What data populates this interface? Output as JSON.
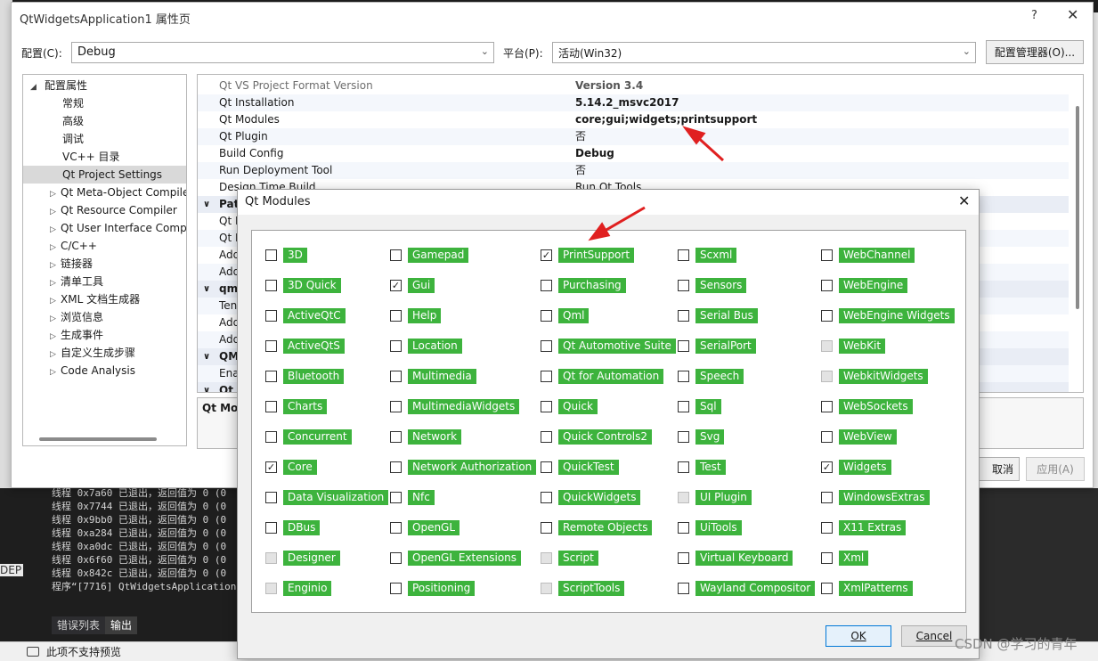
{
  "prop_dialog": {
    "title": "QtWidgetsApplication1 属性页",
    "help": "?",
    "close": "✕",
    "config_label": "配置(C):",
    "config_value": "Debug",
    "platform_label": "平台(P):",
    "platform_value": "活动(Win32)",
    "config_manager": "配置管理器(O)...",
    "cancel": "取消",
    "apply": "应用(A)"
  },
  "tree": [
    {
      "label": "配置属性",
      "arrow": "◢",
      "indent": 0
    },
    {
      "label": "常规",
      "arrow": "",
      "indent": 1
    },
    {
      "label": "高级",
      "arrow": "",
      "indent": 1
    },
    {
      "label": "调试",
      "arrow": "",
      "indent": 1
    },
    {
      "label": "VC++ 目录",
      "arrow": "",
      "indent": 1
    },
    {
      "label": "Qt Project Settings",
      "arrow": "",
      "indent": 1,
      "selected": true
    },
    {
      "label": "Qt Meta-Object Compile",
      "arrow": "▷",
      "indent": 1
    },
    {
      "label": "Qt Resource Compiler",
      "arrow": "▷",
      "indent": 1
    },
    {
      "label": "Qt User Interface Comp",
      "arrow": "▷",
      "indent": 1
    },
    {
      "label": "C/C++",
      "arrow": "▷",
      "indent": 1
    },
    {
      "label": "链接器",
      "arrow": "▷",
      "indent": 1
    },
    {
      "label": "清单工具",
      "arrow": "▷",
      "indent": 1
    },
    {
      "label": "XML 文档生成器",
      "arrow": "▷",
      "indent": 1
    },
    {
      "label": "浏览信息",
      "arrow": "▷",
      "indent": 1
    },
    {
      "label": "生成事件",
      "arrow": "▷",
      "indent": 1
    },
    {
      "label": "自定义生成步骤",
      "arrow": "▷",
      "indent": 1
    },
    {
      "label": "Code Analysis",
      "arrow": "▷",
      "indent": 1
    }
  ],
  "grid": [
    {
      "name": "Qt VS Project Format Version",
      "value": "Version 3.4",
      "bold": true,
      "gray": true
    },
    {
      "name": "Qt Installation",
      "value": "5.14.2_msvc2017",
      "bold": true
    },
    {
      "name": "Qt Modules",
      "value": "core;gui;widgets;printsupport",
      "bold": true
    },
    {
      "name": "Qt Plugin",
      "value": "否",
      "bold": false
    },
    {
      "name": "Build Config",
      "value": "Debug",
      "bold": true
    },
    {
      "name": "Run Deployment Tool",
      "value": "否",
      "bold": false
    },
    {
      "name": "Design Time Build",
      "value": "Run Qt Tools",
      "bold": false
    },
    {
      "cat": true,
      "name": "Pat"
    },
    {
      "name": "Qt I",
      "value": ""
    },
    {
      "name": "Qt I",
      "value": ""
    },
    {
      "name": "Add",
      "value": ""
    },
    {
      "name": "Add",
      "value": ""
    },
    {
      "cat": true,
      "name": "qm"
    },
    {
      "name": "Ten",
      "value": ""
    },
    {
      "name": "Add",
      "value": ""
    },
    {
      "name": "Add",
      "value": ""
    },
    {
      "cat": true,
      "name": "QM"
    },
    {
      "name": "Ena",
      "value": ""
    },
    {
      "cat": true,
      "name": "Qt"
    }
  ],
  "desc_title": "Qt Mo",
  "modules_dialog": {
    "title": "Qt Modules",
    "close": "✕",
    "ok": "OK",
    "cancel": "Cancel",
    "columns": [
      [
        {
          "label": "3D",
          "checked": false
        },
        {
          "label": "3D Quick",
          "checked": false
        },
        {
          "label": "ActiveQtC",
          "checked": false
        },
        {
          "label": "ActiveQtS",
          "checked": false
        },
        {
          "label": "Bluetooth",
          "checked": false
        },
        {
          "label": "Charts",
          "checked": false
        },
        {
          "label": "Concurrent",
          "checked": false
        },
        {
          "label": "Core",
          "checked": true
        },
        {
          "label": "Data Visualization",
          "checked": false
        },
        {
          "label": "DBus",
          "checked": false
        },
        {
          "label": "Designer",
          "checked": false,
          "disabled": true
        },
        {
          "label": "Enginio",
          "checked": false,
          "disabled": true
        }
      ],
      [
        {
          "label": "Gamepad",
          "checked": false
        },
        {
          "label": "Gui",
          "checked": true
        },
        {
          "label": "Help",
          "checked": false
        },
        {
          "label": "Location",
          "checked": false
        },
        {
          "label": "Multimedia",
          "checked": false
        },
        {
          "label": "MultimediaWidgets",
          "checked": false
        },
        {
          "label": "Network",
          "checked": false
        },
        {
          "label": "Network Authorization",
          "checked": false
        },
        {
          "label": "Nfc",
          "checked": false
        },
        {
          "label": "OpenGL",
          "checked": false
        },
        {
          "label": "OpenGL Extensions",
          "checked": false
        },
        {
          "label": "Positioning",
          "checked": false
        }
      ],
      [
        {
          "label": "PrintSupport",
          "checked": true
        },
        {
          "label": "Purchasing",
          "checked": false
        },
        {
          "label": "Qml",
          "checked": false
        },
        {
          "label": "Qt Automotive Suite",
          "checked": false
        },
        {
          "label": "Qt for Automation",
          "checked": false
        },
        {
          "label": "Quick",
          "checked": false
        },
        {
          "label": "Quick Controls2",
          "checked": false
        },
        {
          "label": "QuickTest",
          "checked": false
        },
        {
          "label": "QuickWidgets",
          "checked": false
        },
        {
          "label": "Remote Objects",
          "checked": false
        },
        {
          "label": "Script",
          "checked": false,
          "disabled": true
        },
        {
          "label": "ScriptTools",
          "checked": false,
          "disabled": true
        }
      ],
      [
        {
          "label": "Scxml",
          "checked": false
        },
        {
          "label": "Sensors",
          "checked": false
        },
        {
          "label": "Serial Bus",
          "checked": false
        },
        {
          "label": "SerialPort",
          "checked": false
        },
        {
          "label": "Speech",
          "checked": false
        },
        {
          "label": "Sql",
          "checked": false
        },
        {
          "label": "Svg",
          "checked": false
        },
        {
          "label": "Test",
          "checked": false
        },
        {
          "label": "UI Plugin",
          "checked": false,
          "disabled": true
        },
        {
          "label": "UiTools",
          "checked": false
        },
        {
          "label": "Virtual Keyboard",
          "checked": false
        },
        {
          "label": "Wayland Compositor",
          "checked": false
        }
      ],
      [
        {
          "label": "WebChannel",
          "checked": false
        },
        {
          "label": "WebEngine",
          "checked": false
        },
        {
          "label": "WebEngine Widgets",
          "checked": false
        },
        {
          "label": "WebKit",
          "checked": false,
          "disabled": true
        },
        {
          "label": "WebkitWidgets",
          "checked": false,
          "disabled": true
        },
        {
          "label": "WebSockets",
          "checked": false
        },
        {
          "label": "WebView",
          "checked": false
        },
        {
          "label": "Widgets",
          "checked": true
        },
        {
          "label": "WindowsExtras",
          "checked": false
        },
        {
          "label": "X11 Extras",
          "checked": false
        },
        {
          "label": "Xml",
          "checked": false
        },
        {
          "label": "XmlPatterns",
          "checked": false
        }
      ]
    ]
  },
  "output": {
    "lines": [
      "线程 0x7a60 已退出，返回值为 0 (0",
      "线程 0x7744 已退出，返回值为 0 (0",
      "线程 0x9bb0 已退出，返回值为 0 (0",
      "线程 0xa284 已退出，返回值为 0 (0",
      "线程 0xa0dc 已退出，返回值为 0 (0",
      "线程 0x6f60 已退出，返回值为 0 (0",
      "线程 0x842c 已退出，返回值为 0 (0",
      "程序“[7716] QtWidgetsApplication"
    ],
    "tabs": [
      "错误列表",
      "输出"
    ],
    "dep": "DEP"
  },
  "status_text": "此项不支持预览",
  "watermark": "CSDN @学习的青年"
}
